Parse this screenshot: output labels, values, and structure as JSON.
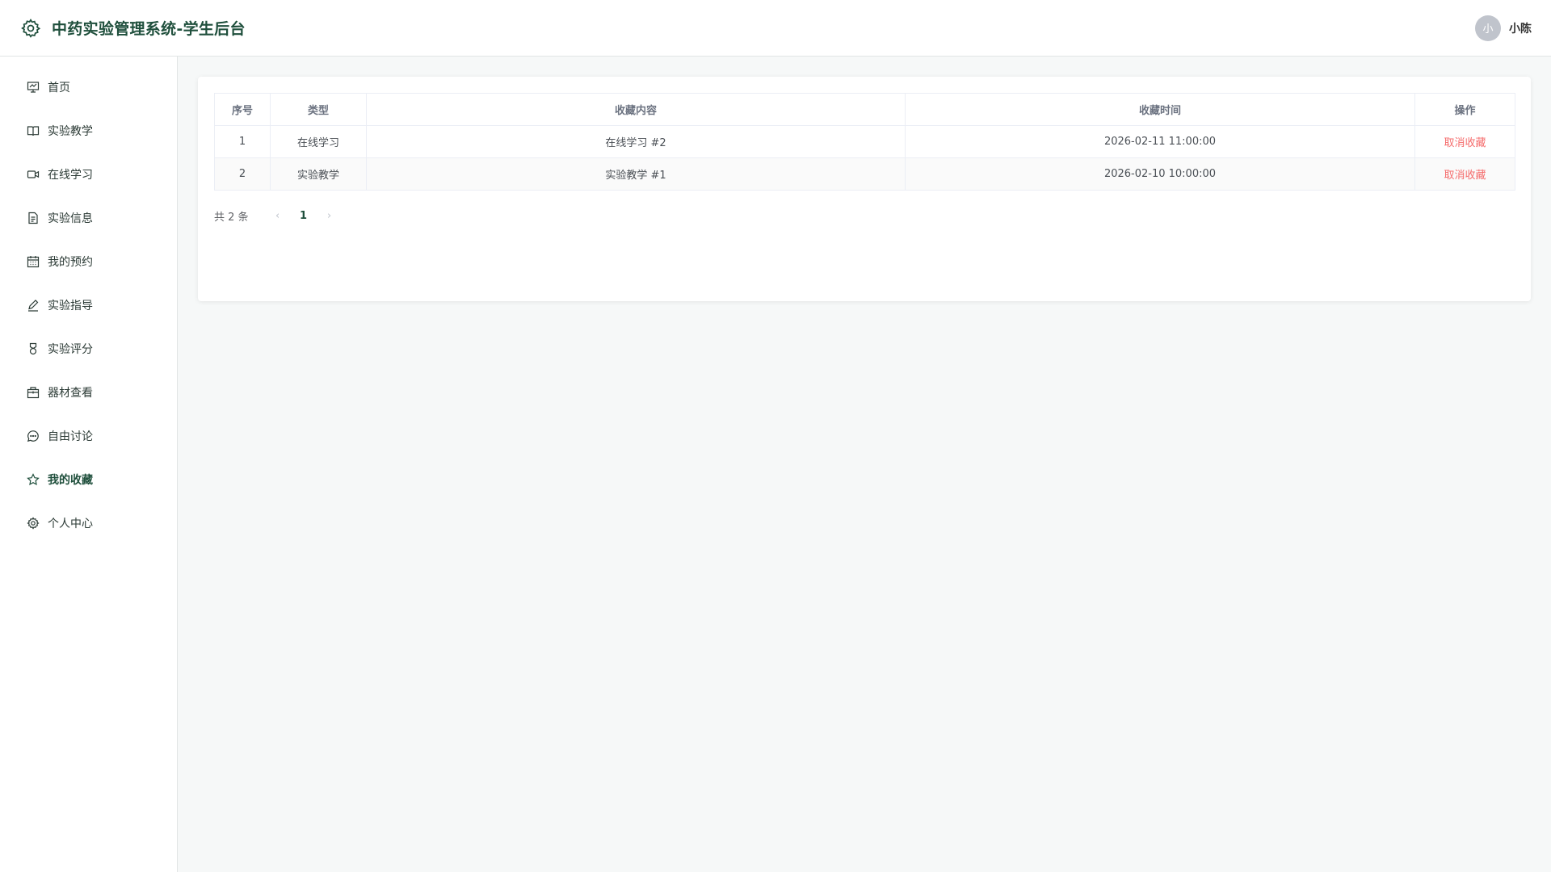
{
  "header": {
    "title": "中药实验管理系统-学生后台",
    "user": {
      "avatar_text": "小",
      "name": "小陈"
    }
  },
  "sidebar": {
    "items": [
      {
        "label": "首页",
        "icon": "home-icon"
      },
      {
        "label": "实验教学",
        "icon": "book-icon"
      },
      {
        "label": "在线学习",
        "icon": "video-icon"
      },
      {
        "label": "实验信息",
        "icon": "document-icon"
      },
      {
        "label": "我的预约",
        "icon": "calendar-icon"
      },
      {
        "label": "实验指导",
        "icon": "edit-icon"
      },
      {
        "label": "实验评分",
        "icon": "medal-icon"
      },
      {
        "label": "器材查看",
        "icon": "box-icon"
      },
      {
        "label": "自由讨论",
        "icon": "chat-icon"
      },
      {
        "label": "我的收藏",
        "icon": "star-icon"
      },
      {
        "label": "个人中心",
        "icon": "gear-icon"
      }
    ],
    "active_index": 9
  },
  "table": {
    "columns": [
      "序号",
      "类型",
      "收藏内容",
      "收藏时间",
      "操作"
    ],
    "rows": [
      {
        "index": "1",
        "type": "在线学习",
        "content": "在线学习 #2",
        "time": "2026-02-11 11:00:00",
        "action": "取消收藏"
      },
      {
        "index": "2",
        "type": "实验教学",
        "content": "实验教学 #1",
        "time": "2026-02-10 10:00:00",
        "action": "取消收藏"
      }
    ]
  },
  "pagination": {
    "total_text": "共 2 条",
    "prev": "‹",
    "current": "1",
    "next": "›"
  },
  "colors": {
    "brand": "#1f4f3c",
    "danger": "#f56c6c",
    "background": "#f6f8f8"
  }
}
